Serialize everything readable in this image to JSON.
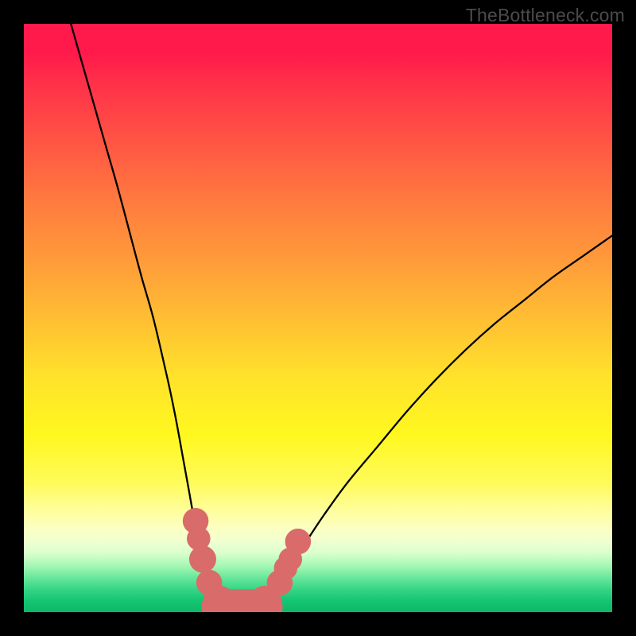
{
  "watermark": {
    "text": "TheBottleneck.com"
  },
  "chart_data": {
    "type": "line",
    "title": "",
    "xlabel": "",
    "ylabel": "",
    "xlim": [
      0,
      100
    ],
    "ylim": [
      0,
      100
    ],
    "series": [
      {
        "name": "left-curve",
        "x": [
          8,
          10,
          12,
          14,
          16,
          18,
          20,
          22,
          24,
          25,
          26,
          27,
          28,
          29,
          30,
          31,
          32,
          33
        ],
        "y": [
          100,
          93,
          86,
          79,
          72,
          64.5,
          57,
          50,
          41.5,
          37,
          32,
          26.5,
          21,
          15.5,
          11,
          7.5,
          4.5,
          2
        ]
      },
      {
        "name": "right-curve",
        "x": [
          41,
          43,
          45,
          48,
          51,
          55,
          60,
          65,
          70,
          75,
          80,
          85,
          90,
          95,
          100
        ],
        "y": [
          2,
          4.5,
          7.5,
          12,
          16.5,
          22,
          28,
          34,
          39.5,
          44.5,
          49,
          53,
          57,
          60.5,
          64
        ]
      }
    ],
    "markers": {
      "name": "highlight-points",
      "color": "#d96b6b",
      "points": [
        {
          "x": 29.2,
          "y": 15.5,
          "r": 2.2
        },
        {
          "x": 29.7,
          "y": 12.5,
          "r": 2.0
        },
        {
          "x": 30.4,
          "y": 9.0,
          "r": 2.3
        },
        {
          "x": 31.5,
          "y": 5.0,
          "r": 2.2
        },
        {
          "x": 33.2,
          "y": 1.7,
          "r": 2.8
        },
        {
          "x": 36.0,
          "y": 0.9,
          "r": 2.5
        },
        {
          "x": 38.8,
          "y": 0.9,
          "r": 2.5
        },
        {
          "x": 41.0,
          "y": 1.7,
          "r": 2.8
        },
        {
          "x": 43.5,
          "y": 5.0,
          "r": 2.2
        },
        {
          "x": 44.5,
          "y": 7.5,
          "r": 2.0
        },
        {
          "x": 45.3,
          "y": 9.0,
          "r": 2.0
        },
        {
          "x": 46.6,
          "y": 12.0,
          "r": 2.2
        }
      ]
    },
    "flat_segment": {
      "name": "valley-floor",
      "color": "#d96b6b",
      "x0": 33.2,
      "x1": 41.0,
      "y": 0.9,
      "thickness": 3.0
    },
    "gradient_stops": [
      {
        "pos": 0,
        "color": "#ff1a4b"
      },
      {
        "pos": 50,
        "color": "#ffbe33"
      },
      {
        "pos": 70,
        "color": "#fff81f"
      },
      {
        "pos": 90,
        "color": "#d8ffcc"
      },
      {
        "pos": 100,
        "color": "#0db866"
      }
    ]
  }
}
